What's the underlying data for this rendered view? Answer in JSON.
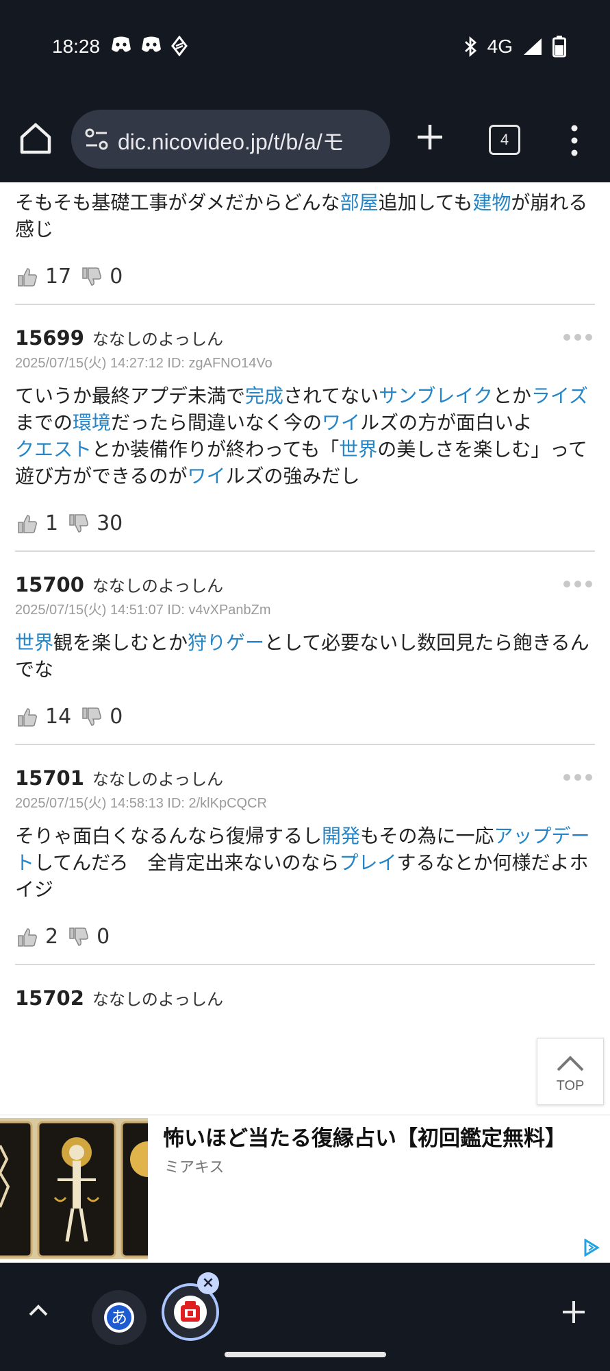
{
  "status": {
    "time": "18:28",
    "network": "4G",
    "left_icons": [
      "discord-icon",
      "discord-icon",
      "app-icon"
    ],
    "right_icons": [
      "bluetooth-icon",
      "signal-icon",
      "battery-icon"
    ]
  },
  "browser": {
    "url": "dic.nicovideo.jp/t/b/a/モ",
    "tab_count": "4"
  },
  "partial_post": {
    "segments": [
      {
        "t": "そもそも基礎工事がダメだからどんな",
        "link": false
      },
      {
        "t": "部屋",
        "link": true
      },
      {
        "t": "追加しても",
        "link": false
      },
      {
        "t": "建物",
        "link": true
      },
      {
        "t": "が崩れる感じ",
        "link": false
      }
    ],
    "good": "17",
    "bad": "0"
  },
  "posts": [
    {
      "no": "15699",
      "name": "ななしのよっしん",
      "date": "2025/07/15(火) 14:27:12 ID: zgAFNO14Vo",
      "segments": [
        {
          "t": "ていうか最終アプデ未満で",
          "link": false
        },
        {
          "t": "完成",
          "link": true
        },
        {
          "t": "されてない",
          "link": false
        },
        {
          "t": "サンブレイク",
          "link": true
        },
        {
          "t": "とか",
          "link": false
        },
        {
          "t": "ライズ",
          "link": true
        },
        {
          "t": "までの",
          "link": false
        },
        {
          "t": "環境",
          "link": true
        },
        {
          "t": "だったら間違いなく今の",
          "link": false
        },
        {
          "t": "ワイ",
          "link": true
        },
        {
          "t": "ルズの方が面白いよ",
          "link": false
        },
        {
          "br": true
        },
        {
          "t": "クエスト",
          "link": true
        },
        {
          "t": "とか装備作りが終わっても「",
          "link": false
        },
        {
          "t": "世界",
          "link": true
        },
        {
          "t": "の美しさを楽しむ」って遊び方ができるのが",
          "link": false
        },
        {
          "t": "ワイ",
          "link": true
        },
        {
          "t": "ルズの強みだし",
          "link": false
        }
      ],
      "good": "1",
      "bad": "30"
    },
    {
      "no": "15700",
      "name": "ななしのよっしん",
      "date": "2025/07/15(火) 14:51:07 ID: v4vXPanbZm",
      "segments": [
        {
          "t": "世界",
          "link": true
        },
        {
          "t": "観を楽しむとか",
          "link": false
        },
        {
          "t": "狩りゲー",
          "link": true
        },
        {
          "t": "として必要ないし数回見たら飽きるんでな",
          "link": false
        }
      ],
      "good": "14",
      "bad": "0"
    },
    {
      "no": "15701",
      "name": "ななしのよっしん",
      "date": "2025/07/15(火) 14:58:13 ID: 2/klKpCQCR",
      "segments": [
        {
          "t": "そりゃ面白くなるんなら復帰するし",
          "link": false
        },
        {
          "t": "開発",
          "link": true
        },
        {
          "t": "もその為に一応",
          "link": false
        },
        {
          "t": "アップデート",
          "link": true
        },
        {
          "t": "してんだろ　全肯定出来ないのなら",
          "link": false
        },
        {
          "t": "プレイ",
          "link": true
        },
        {
          "t": "するなとか何様だよホイジ",
          "link": false
        }
      ],
      "good": "2",
      "bad": "0"
    },
    {
      "no": "15702",
      "name": "ななしのよっしん",
      "date": "",
      "segments": [],
      "good": "",
      "bad": ""
    }
  ],
  "top_button": "TOP",
  "ad": {
    "title": "怖いほど当たる復縁占い【初回鑑定無料】",
    "advertiser": "ミアキス"
  },
  "bottom": {
    "tab_a_label": "あ",
    "close_label": "×"
  },
  "colors": {
    "link": "#2585c6",
    "chrome_bg": "#141821",
    "url_bg": "#323846"
  }
}
